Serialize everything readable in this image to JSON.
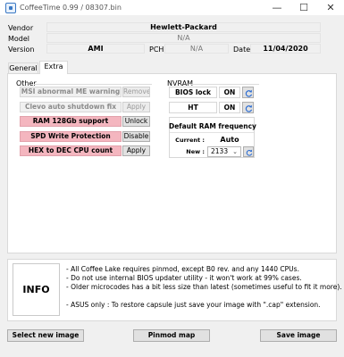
{
  "window": {
    "title": "CoffeeTime 0.99  /  08307.bin",
    "minimize_glyph": "—",
    "maximize_glyph": "☐",
    "close_glyph": "✕"
  },
  "info": {
    "vendor_label": "Vendor",
    "vendor_value": "Hewlett-Packard",
    "model_label": "Model",
    "model_value": "N/A",
    "version_label": "Version",
    "version_value": "AMI",
    "pch_label": "PCH",
    "pch_value": "N/A",
    "date_label": "Date",
    "date_value": "11/04/2020"
  },
  "tabs": [
    {
      "label": "General"
    },
    {
      "label": "Extra"
    }
  ],
  "other": {
    "title": "Other",
    "items": [
      {
        "label": "MSI abnormal ME warning",
        "button": "Remove"
      },
      {
        "label": "Clevo auto shutdown fix",
        "button": "Apply"
      },
      {
        "label": "RAM 128Gb support",
        "button": "Unlock"
      },
      {
        "label": "SPD Write Protection",
        "button": "Disable"
      },
      {
        "label": "HEX to DEC CPU count",
        "button": "Apply"
      }
    ]
  },
  "nvram": {
    "title": "NVRAM",
    "bios_lock_label": "BIOS lock",
    "bios_lock_value": "ON",
    "ht_label": "HT",
    "ht_value": "ON",
    "ram_title": "Default RAM frequency",
    "current_label": "Current :",
    "current_value": "Auto",
    "new_label": "New :",
    "new_value": "2133"
  },
  "infobox": {
    "label": "INFO",
    "lines": [
      "- All Coffee Lake requires pinmod, except B0 rev. and any 1440 CPUs.",
      "- Do not use internal BIOS updater utility - it won't work at 99% cases.",
      "- Older microcodes has a bit less size than latest (sometimes useful to fit it more).",
      "",
      "- ASUS only : To restore capsule just save your image with \".cap\" extension."
    ]
  },
  "actions": {
    "select_label": "Select new image",
    "pinmod_label": "Pinmod map",
    "save_label": "Save image"
  },
  "colors": {
    "enabled_option": "#f4b6bf",
    "window_bg": "#f0f0f0",
    "refresh_icon": "#2a6bd1"
  }
}
